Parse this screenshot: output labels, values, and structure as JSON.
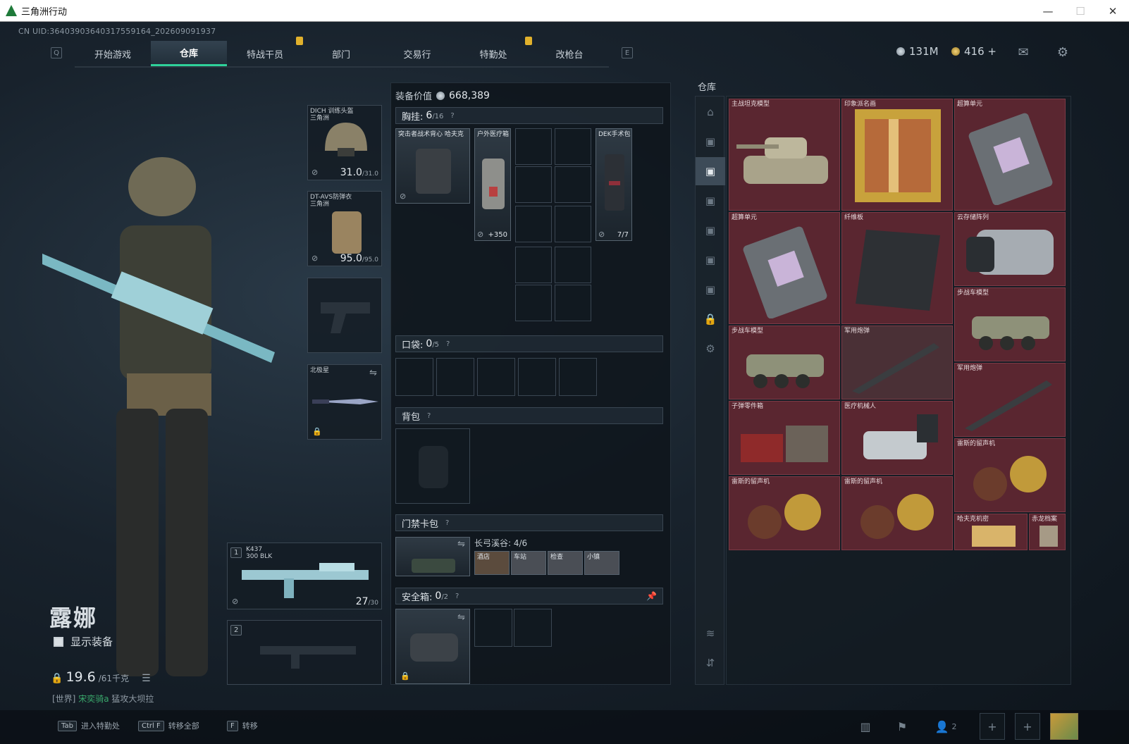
{
  "window": {
    "title": "三角洲行动"
  },
  "uid": "CN UID:3640390364031755916‌4_202609091937",
  "nav": {
    "key_left": "Q",
    "key_right": "E",
    "items": [
      "开始游戏",
      "仓库",
      "特战干员",
      "部门",
      "交易行",
      "特勤处",
      "改枪台"
    ],
    "active": "仓库"
  },
  "currency": {
    "silver": "131M",
    "gold": "416 +"
  },
  "character": {
    "name": "露娜",
    "show_equipment_label": "显示装备",
    "weight_value": "19.6",
    "weight_max": "/61千克",
    "world_prefix": "[世界]",
    "world_user": "宋奕骑a",
    "world_text": "猛攻大坝拉"
  },
  "equipment": {
    "helmet": {
      "name": "DICH 训练头盔",
      "sub": "三角洲",
      "value": "31.0",
      "max": "/31.0"
    },
    "armor": {
      "name": "DT-AVS防弹衣",
      "sub": "三角洲",
      "value": "95.0",
      "max": "/95.0"
    },
    "melee": {
      "name": "北极星"
    },
    "primary": {
      "slot": "1",
      "name": "K437",
      "sub": "300 BLK",
      "ammo": "27",
      "ammo_max": "/30"
    },
    "secondary": {
      "slot": "2"
    }
  },
  "middle": {
    "value_label": "装备价值",
    "value": "668,389",
    "chest": {
      "label": "胸挂:",
      "count": "6",
      "max": "/16"
    },
    "chest_items": [
      {
        "name": "突击者战术背心 哈夫克"
      },
      {
        "name": "户外医疗箱",
        "num": "350"
      },
      {
        "name": "DEK手术包",
        "num": "7/7"
      }
    ],
    "pocket": {
      "label": "口袋:",
      "count": "0",
      "max": "/5"
    },
    "backpack": {
      "label": "背包"
    },
    "keycard": {
      "label": "门禁卡包",
      "map": "长弓溪谷: 4/6",
      "cards": [
        "酒店",
        "车站",
        "检查",
        "小镇"
      ]
    },
    "safebox": {
      "label": "安全箱:",
      "count": "0",
      "max": "/2"
    }
  },
  "warehouse": {
    "title": "仓库",
    "items": [
      {
        "name": "主战坦克模型"
      },
      {
        "name": "印象派名画"
      },
      {
        "name": "超算单元"
      },
      {
        "name": "超算单元"
      },
      {
        "name": "纤维板"
      },
      {
        "name": "云存储阵列"
      },
      {
        "name": "步战车模型"
      },
      {
        "name": "步战车模型"
      },
      {
        "name": "军用炮弹"
      },
      {
        "name": "军用炮弹"
      },
      {
        "name": "子弹零件箱"
      },
      {
        "name": "医疗机械人"
      },
      {
        "name": "雷斯的留声机"
      },
      {
        "name": "雷斯的留声机"
      },
      {
        "name": "雷斯的留声机"
      },
      {
        "name": "哈夫克机密"
      },
      {
        "name": "赤龙档案"
      }
    ]
  },
  "bottom": {
    "hints": [
      {
        "key": "Tab",
        "label": "进入特勤处"
      },
      {
        "key": "Ctrl F",
        "label": "转移全部"
      },
      {
        "key": "F",
        "label": "转移"
      }
    ],
    "friends": "2"
  },
  "colors": {
    "accent": "#2fd19a",
    "warehouse_item": "#5a2630"
  }
}
